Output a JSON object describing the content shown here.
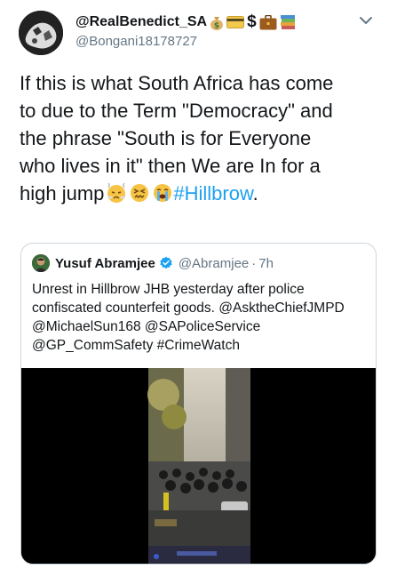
{
  "tweet": {
    "display_name": "@RealBenedict_SA",
    "name_emojis": [
      "money-bag",
      "credit-card",
      "dollar-sign",
      "briefcase",
      "books"
    ],
    "dollar_glyph": "$",
    "handle": "@Bongani18178727",
    "text_line1": "If this is what South Africa has come",
    "text_line2": "to due to the Term \"Democracy\" and",
    "text_line3": "the phrase \"South is for Everyone",
    "text_line4": "who lives in it\" then We are In for a",
    "text_line5_start": "high jump",
    "text_emojis": [
      "steaming-face",
      "confounded-face",
      "crying-face"
    ],
    "hashtag": "#Hillbrow",
    "text_end": "."
  },
  "quote": {
    "display_name": "Yusuf Abramjee",
    "verified": true,
    "handle": "@Abramjee",
    "separator": "·",
    "time": "7h",
    "text": "Unrest in Hillbrow JHB yesterday after police\nconfiscated counterfeit goods. @AsktheChiefJMPD\n@MichaelSun168 @SAPoliceService\n@GP_CommSafety #CrimeWatch"
  },
  "colors": {
    "link": "#1da1f2",
    "secondary": "#657786",
    "border": "#ccd6dd",
    "verified": "#1da1f2"
  }
}
